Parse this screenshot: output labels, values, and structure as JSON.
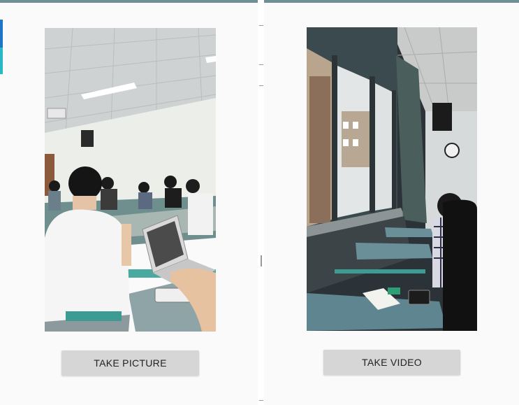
{
  "left_screen": {
    "photo_description_icon": "classroom-students-photo",
    "button_label": "TAKE PICTURE"
  },
  "right_screen": {
    "photo_description_icon": "classroom-window-video-frame",
    "button_label": "TAKE VIDEO"
  },
  "colors": {
    "background": "#fafafa",
    "button": "#d6d6d6",
    "status_bar": "#6f8f95",
    "edge_blue": "#1e74c6",
    "edge_teal": "#28b9c4"
  }
}
